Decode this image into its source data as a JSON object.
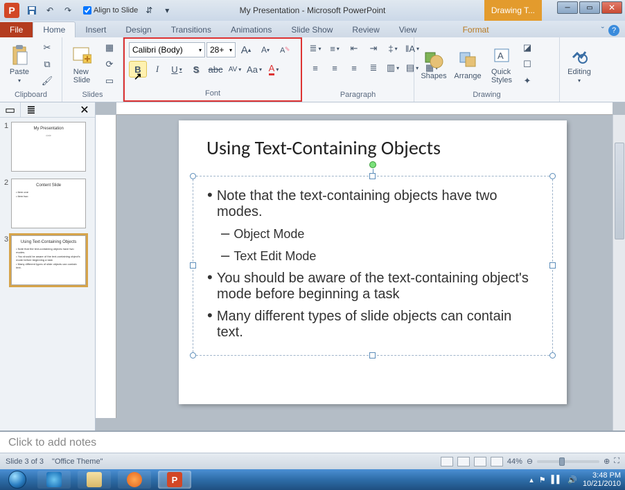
{
  "window": {
    "title": "My Presentation  -  Microsoft PowerPoint",
    "context_tab": "Drawing T...",
    "qat_align_label": "Align to Slide"
  },
  "tabs": {
    "file": "File",
    "items": [
      "Home",
      "Insert",
      "Design",
      "Transitions",
      "Animations",
      "Slide Show",
      "Review",
      "View",
      "Format"
    ],
    "active": "Home"
  },
  "ribbon": {
    "clipboard": {
      "label": "Clipboard",
      "paste": "Paste"
    },
    "slides": {
      "label": "Slides",
      "new_slide": "New\nSlide"
    },
    "font": {
      "label": "Font",
      "name": "Calibri (Body)",
      "size": "28+"
    },
    "paragraph": {
      "label": "Paragraph"
    },
    "drawing": {
      "label": "Drawing",
      "shapes": "Shapes",
      "arrange": "Arrange",
      "quick_styles": "Quick\nStyles"
    },
    "editing": {
      "label": "Editing",
      "btn": "Editing"
    }
  },
  "thumbnails": {
    "slides": [
      {
        "num": "1",
        "title": "My Presentation",
        "lines": []
      },
      {
        "num": "2",
        "title": "Content Slide",
        "lines": [
          "• item one",
          "• item two"
        ]
      },
      {
        "num": "3",
        "title": "Using Text-Containing Objects",
        "lines": [
          "• Note that the text-containing objects have two modes.",
          "• You should be aware of the text-containing object's mode before beginning a task",
          "• Many different types of slide objects can contain text."
        ]
      }
    ],
    "active_index": 2
  },
  "slide": {
    "title": "Using Text-Containing Objects",
    "bullets": [
      {
        "level": 0,
        "text": "Note that the text-containing objects have two modes."
      },
      {
        "level": 1,
        "text": "Object Mode"
      },
      {
        "level": 1,
        "text": "Text Edit Mode"
      },
      {
        "level": 0,
        "text": "You should be aware of the text-containing object's mode before beginning a task"
      },
      {
        "level": 0,
        "text": "Many different types of slide objects can contain text."
      }
    ]
  },
  "notes": {
    "placeholder": "Click to add notes"
  },
  "status": {
    "slide_pos": "Slide 3 of 3",
    "theme": "\"Office Theme\"",
    "zoom": "44%"
  },
  "taskbar": {
    "time": "3:48 PM",
    "date": "10/21/2010"
  }
}
